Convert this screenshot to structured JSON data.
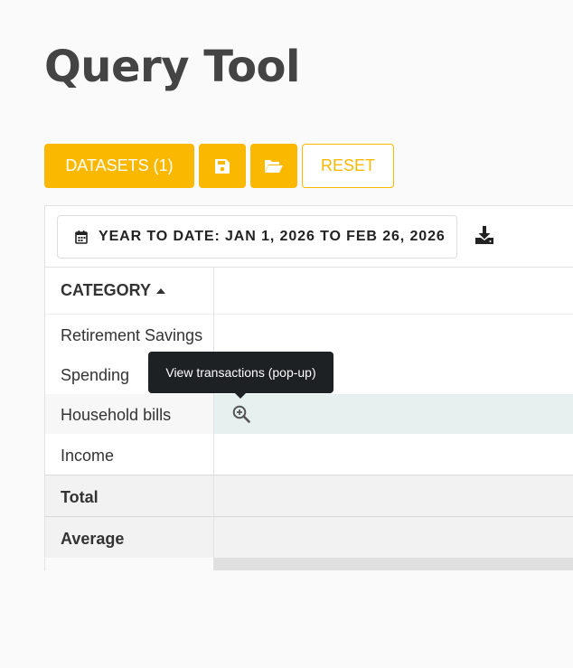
{
  "page": {
    "title": "Query Tool"
  },
  "toolbar": {
    "datasets_label": "DATASETS (1)",
    "save_icon": "save-icon",
    "open_icon": "folder-open-icon",
    "reset_label": "RESET"
  },
  "date_filter": {
    "label": "YEAR TO DATE: JAN 1, 2026 TO FEB 26, 2026",
    "icon": "calendar-icon"
  },
  "download": {
    "icon": "download-icon"
  },
  "table": {
    "header": {
      "category_label": "CATEGORY",
      "sort_icon": "caret-up-icon"
    },
    "rows": [
      {
        "label": "Retirement Savings"
      },
      {
        "label": "Spending"
      },
      {
        "label": "Household bills"
      },
      {
        "label": "Income"
      }
    ],
    "summary": [
      {
        "label": "Total"
      },
      {
        "label": "Average"
      }
    ]
  },
  "tooltip": {
    "text": "View transactions (pop-up)"
  },
  "colors": {
    "accent": "#fbb800",
    "hover_row": "#e6f0ef",
    "summary_row": "#f2f2f2",
    "tooltip_bg": "#1e2124"
  }
}
